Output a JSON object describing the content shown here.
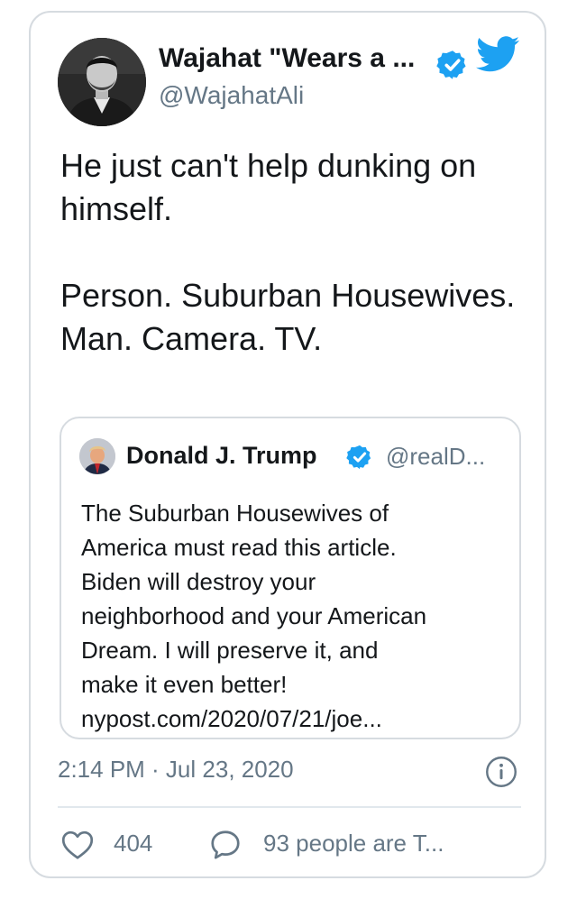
{
  "colors": {
    "twitter_blue": "#1da1f2",
    "border": "#d6dbe0",
    "secondary_text": "#657786",
    "primary_text": "#14171a"
  },
  "tweet": {
    "author_name": "Wajahat \"Wears a ...",
    "author_handle": "@WajahatAli",
    "verified": true,
    "text_paragraphs": [
      "He just can't help dunking on himself.",
      "Person. Suburban Housewives. Man. Camera. TV."
    ],
    "timestamp": "2:14 PM · Jul 23, 2020",
    "likes": "404",
    "reply_label": "93 people are T..."
  },
  "quoted_tweet": {
    "author_name": "Donald J. Trump",
    "author_handle": "@realD...",
    "verified": true,
    "text_lines": [
      "The Suburban Housewives of",
      "America must read this article.",
      "Biden will destroy your",
      "neighborhood and your American",
      "Dream. I will preserve it, and",
      "make it even better!",
      "nypost.com/2020/07/21/joe..."
    ]
  },
  "icons": {
    "brand": "twitter-bird-icon",
    "verified": "verified-badge-icon",
    "info": "info-icon",
    "like": "heart-icon",
    "reply": "speech-bubble-icon"
  }
}
